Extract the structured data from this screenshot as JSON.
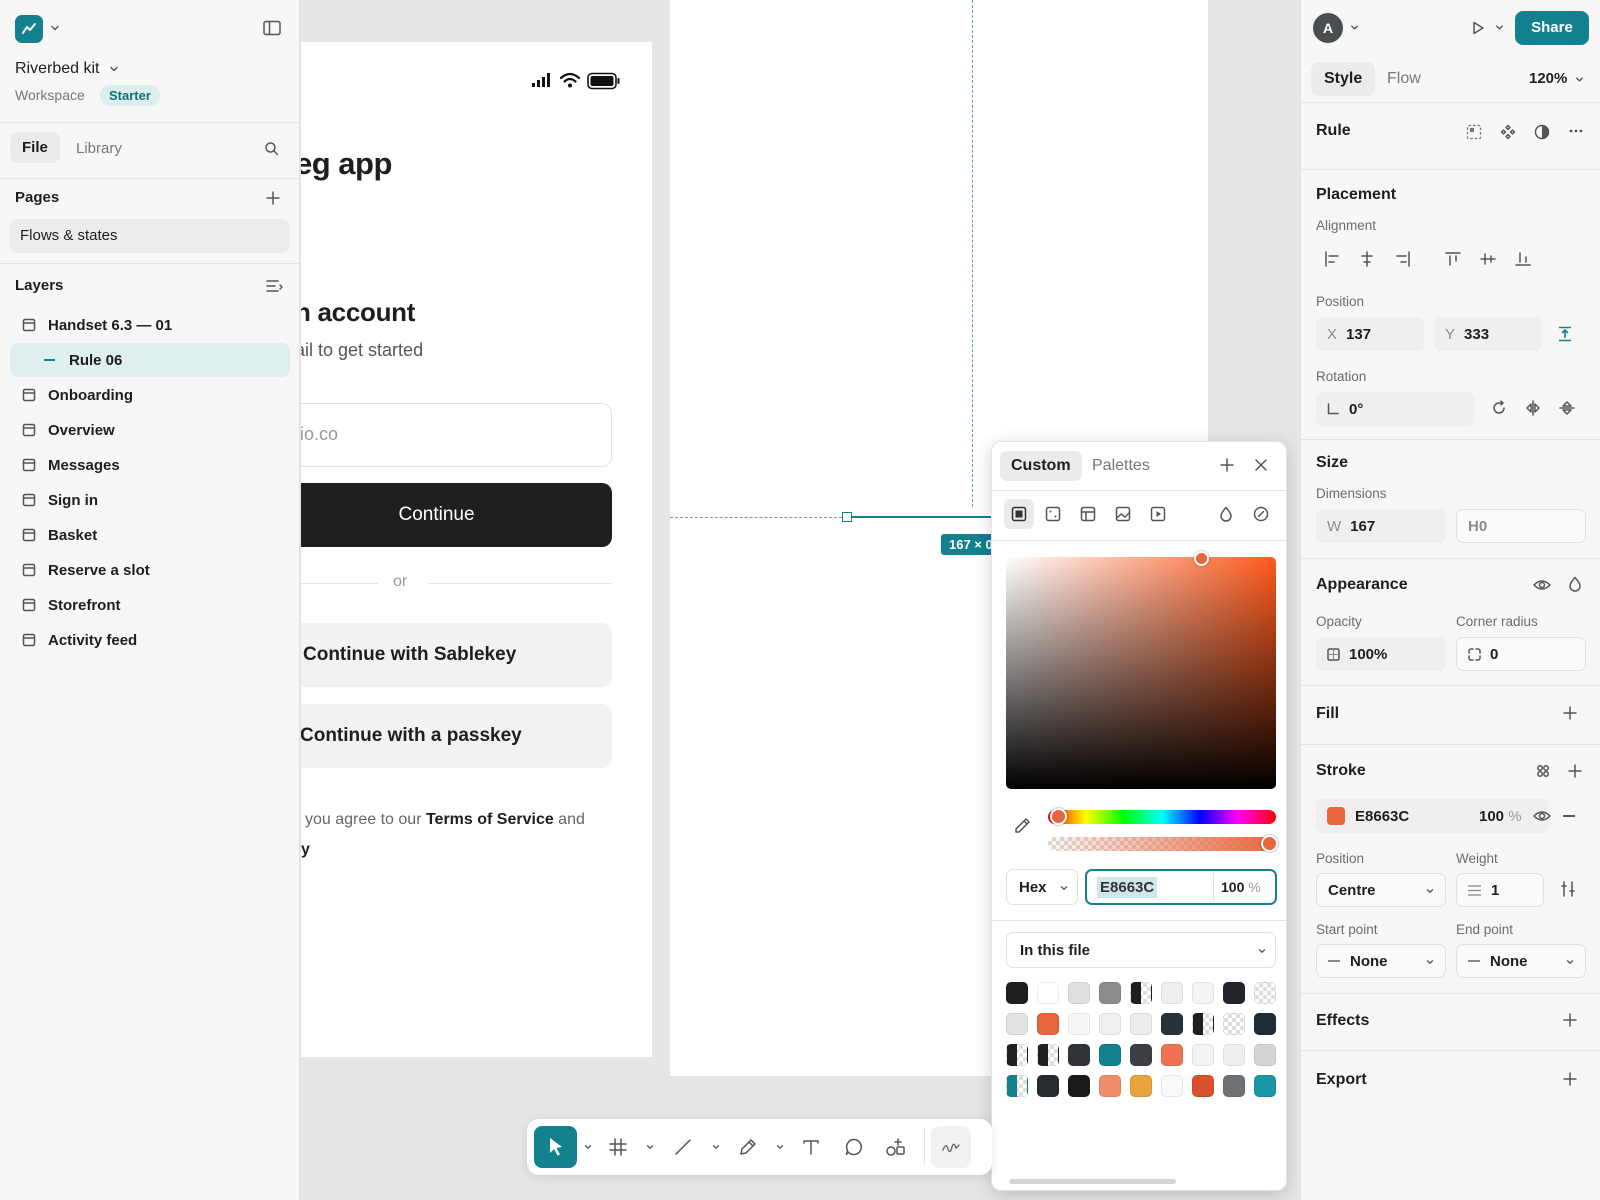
{
  "app": {
    "project_name": "Riverbed kit",
    "workspace_label": "Workspace",
    "plan_badge": "Starter"
  },
  "left_tabs": [
    "File",
    "Library"
  ],
  "pages": {
    "title": "Pages",
    "items": [
      "Flows & states"
    ]
  },
  "layers": {
    "title": "Layers",
    "items": [
      {
        "label": "Handset 6.3 — 01",
        "selected": false
      },
      {
        "label": "Rule 06",
        "selected": true
      },
      {
        "label": "Onboarding",
        "selected": false
      },
      {
        "label": "Overview",
        "selected": false
      },
      {
        "label": "Messages",
        "selected": false
      },
      {
        "label": "Sign in",
        "selected": false
      },
      {
        "label": "Basket",
        "selected": false
      },
      {
        "label": "Reserve a slot",
        "selected": false
      },
      {
        "label": "Storefront",
        "selected": false
      },
      {
        "label": "Activity feed",
        "selected": false
      }
    ]
  },
  "phone": {
    "heading": "eg app",
    "subheading": "n account",
    "subtext": "ail to get started",
    "email_placeholder": "io.co",
    "continue_label": "Continue",
    "divider_label": "or",
    "sablekey_label": "Continue with Sablekey",
    "passkey_label": "Continue with a passkey",
    "terms_prefix": "you agree to our ",
    "terms_link": "Terms of Service",
    "terms_suffix": " and",
    "terms_line2": "y"
  },
  "canvas": {
    "measure_label": "167 × 0"
  },
  "picker": {
    "tabs": [
      "Custom",
      "Palettes"
    ],
    "format": "Hex",
    "hex_value": "E8663C",
    "opacity_value": "100",
    "percent_sign": "%",
    "library_select": "In this file",
    "swatches": [
      "#1d1f21",
      "#ffffff",
      "#e0e0e0",
      "#8c8c8c",
      "half",
      "#eeeeee",
      "#f5f5f5",
      "#212428",
      "checker",
      "#e3e3e3",
      "#e8663c",
      "#f8f8f8",
      "#f0f0f0",
      "#ececec",
      "#26333d",
      "half",
      "checker",
      "#1f2b34",
      "half",
      "half",
      "#30353a",
      "#13818e",
      "#3b4045",
      "#ef7352",
      "#f4f4f4",
      "#eeeeee",
      "#d6d6d6",
      "half-teal",
      "#272a2e",
      "#18191b",
      "#ef8e6c",
      "#e8a43c",
      "#fafafa",
      "#d9512c",
      "#6f7274",
      "#1a97a8"
    ]
  },
  "right": {
    "avatar_letter": "A",
    "share_label": "Share",
    "tabs": [
      "Style",
      "Flow"
    ],
    "zoom": "120%",
    "selection_name": "Rule",
    "placement": {
      "title": "Placement",
      "alignment_label": "Alignment",
      "position_label": "Position",
      "x_prefix": "X",
      "x_value": "137",
      "y_prefix": "Y",
      "y_value": "333",
      "rotation_label": "Rotation",
      "rotation_value": "0°"
    },
    "size": {
      "title": "Size",
      "dimensions_label": "Dimensions",
      "w_prefix": "W",
      "w_value": "167",
      "h_prefix": "H",
      "h_value": "0"
    },
    "appearance": {
      "title": "Appearance",
      "opacity_label": "Opacity",
      "opacity_value": "100%",
      "radius_label": "Corner radius",
      "radius_value": "0"
    },
    "fill_title": "Fill",
    "stroke": {
      "title": "Stroke",
      "color_hex": "E8663C",
      "color": "#e8663c",
      "opacity": "100",
      "percent_sign": "%",
      "position_label": "Position",
      "position_value": "Centre",
      "weight_label": "Weight",
      "weight_value": "1",
      "start_label": "Start point",
      "start_value": "None",
      "end_label": "End point",
      "end_value": "None"
    },
    "effects_title": "Effects",
    "export_title": "Export"
  }
}
